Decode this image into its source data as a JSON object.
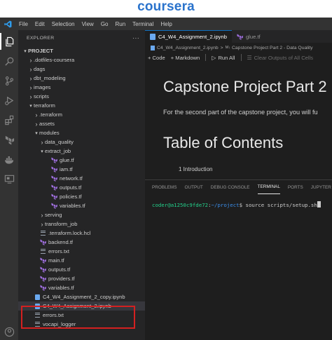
{
  "brand": {
    "logo_text": "coursera",
    "color": "#2a73cc"
  },
  "menu": [
    "File",
    "Edit",
    "Selection",
    "View",
    "Go",
    "Run",
    "Terminal",
    "Help"
  ],
  "sidebar": {
    "title": "EXPLORER",
    "more": "···",
    "tree": [
      {
        "label": "PROJECT",
        "depth": 0,
        "kind": "root",
        "expanded": true
      },
      {
        "label": ".dotfiles-coursera",
        "depth": 1,
        "kind": "folder",
        "expanded": false
      },
      {
        "label": "dags",
        "depth": 1,
        "kind": "folder",
        "expanded": false
      },
      {
        "label": "dbt_modeling",
        "depth": 1,
        "kind": "folder",
        "expanded": false
      },
      {
        "label": "images",
        "depth": 1,
        "kind": "folder",
        "expanded": false
      },
      {
        "label": "scripts",
        "depth": 1,
        "kind": "folder",
        "expanded": false
      },
      {
        "label": "terraform",
        "depth": 1,
        "kind": "folder",
        "expanded": true
      },
      {
        "label": ".terraform",
        "depth": 2,
        "kind": "folder",
        "expanded": false
      },
      {
        "label": "assets",
        "depth": 2,
        "kind": "folder",
        "expanded": false
      },
      {
        "label": "modules",
        "depth": 2,
        "kind": "folder",
        "expanded": true
      },
      {
        "label": "data_quality",
        "depth": 3,
        "kind": "folder",
        "expanded": false
      },
      {
        "label": "extract_job",
        "depth": 3,
        "kind": "folder",
        "expanded": true
      },
      {
        "label": "glue.tf",
        "depth": 4,
        "kind": "tf"
      },
      {
        "label": "iam.tf",
        "depth": 4,
        "kind": "tf"
      },
      {
        "label": "network.tf",
        "depth": 4,
        "kind": "tf"
      },
      {
        "label": "outputs.tf",
        "depth": 4,
        "kind": "tf"
      },
      {
        "label": "policies.tf",
        "depth": 4,
        "kind": "tf"
      },
      {
        "label": "variables.tf",
        "depth": 4,
        "kind": "tf"
      },
      {
        "label": "serving",
        "depth": 3,
        "kind": "folder",
        "expanded": false
      },
      {
        "label": "transform_job",
        "depth": 3,
        "kind": "folder",
        "expanded": false
      },
      {
        "label": ".terraform.lock.hcl",
        "depth": 2,
        "kind": "lines"
      },
      {
        "label": "backend.tf",
        "depth": 2,
        "kind": "tf"
      },
      {
        "label": "errors.txt",
        "depth": 2,
        "kind": "lines"
      },
      {
        "label": "main.tf",
        "depth": 2,
        "kind": "tf"
      },
      {
        "label": "outputs.tf",
        "depth": 2,
        "kind": "tf"
      },
      {
        "label": "providers.tf",
        "depth": 2,
        "kind": "tf"
      },
      {
        "label": "variables.tf",
        "depth": 2,
        "kind": "tf"
      },
      {
        "label": "C4_W4_Assignment_2_copy.ipynb",
        "depth": 1,
        "kind": "notebook"
      },
      {
        "label": "C4_W4_Assignment_2.ipynb",
        "depth": 1,
        "kind": "notebook",
        "selected": true
      },
      {
        "label": "errors.txt",
        "depth": 1,
        "kind": "lines"
      },
      {
        "label": "vocapi_logger",
        "depth": 1,
        "kind": "lines"
      }
    ]
  },
  "editor": {
    "tabs": [
      {
        "label": "C4_W4_Assignment_2.ipynb",
        "active": true
      },
      {
        "label": "glue.tf",
        "active": false
      }
    ],
    "breadcrumb": {
      "file": "C4_W4_Assignment_2.ipynb",
      "sep": ">",
      "md_badge": "M↓",
      "section": "Capstone Project Part 2 - Data Quality"
    },
    "toolbar": {
      "code": "+ Code",
      "markdown": "+ Markdown",
      "run_all": "Run All",
      "clear": "Clear Outputs of All Cells"
    },
    "notebook": {
      "h1": "Capstone Project Part 2",
      "intro": "For the second part of the capstone project, you will fu",
      "h2": "Table of Contents",
      "cut_line": "1 Introduction"
    }
  },
  "panel": {
    "tabs": [
      "PROBLEMS",
      "OUTPUT",
      "DEBUG CONSOLE",
      "TERMINAL",
      "PORTS",
      "JUPYTER"
    ],
    "active_tab": "TERMINAL",
    "terminal": {
      "user": "coder@a1250c9fde72",
      "sep": ":",
      "path": "~/project",
      "prompt": "$",
      "command": " source scripts/setup.sh"
    }
  },
  "colors": {
    "activity_bar": "#333333",
    "sidebar": "#252526",
    "editor": "#1e1e1e",
    "tf_icon": "#a070e0",
    "notebook_icon": "#6aa9f0",
    "folder_chevron": "#c5c5c5",
    "highlight": "#d42020"
  },
  "icons": {
    "activity": [
      "files-icon",
      "search-icon",
      "source-control-icon",
      "run-debug-icon",
      "extensions-icon",
      "terraform-icon",
      "docker-icon",
      "remote-explorer-icon",
      "account-icon"
    ]
  }
}
